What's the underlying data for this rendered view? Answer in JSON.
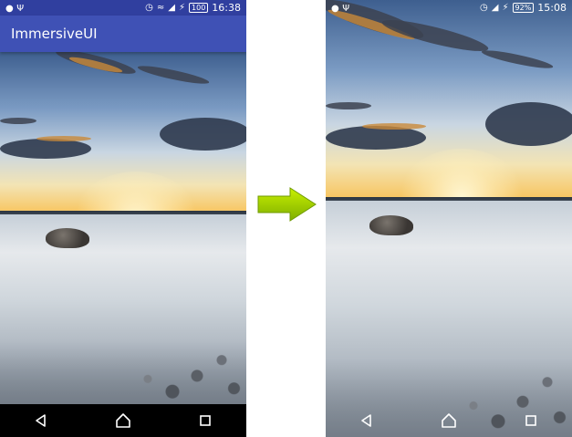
{
  "left_screen": {
    "status_bar": {
      "time": "16:38",
      "battery": "100"
    },
    "app_bar": {
      "title": "ImmersiveUI"
    }
  },
  "right_screen": {
    "status_bar": {
      "time": "15:08",
      "battery": "92%"
    }
  },
  "colors": {
    "app_bar": "#3f51b5",
    "status_bar": "#303f9f",
    "arrow": "#9acd00"
  },
  "icons": {
    "status_left": [
      "android-icon",
      "usb-icon"
    ],
    "status_right": [
      "alarm-icon",
      "wifi-icon",
      "signal-icon",
      "charging-icon"
    ],
    "nav": [
      "back-icon",
      "home-icon",
      "recents-icon"
    ]
  }
}
